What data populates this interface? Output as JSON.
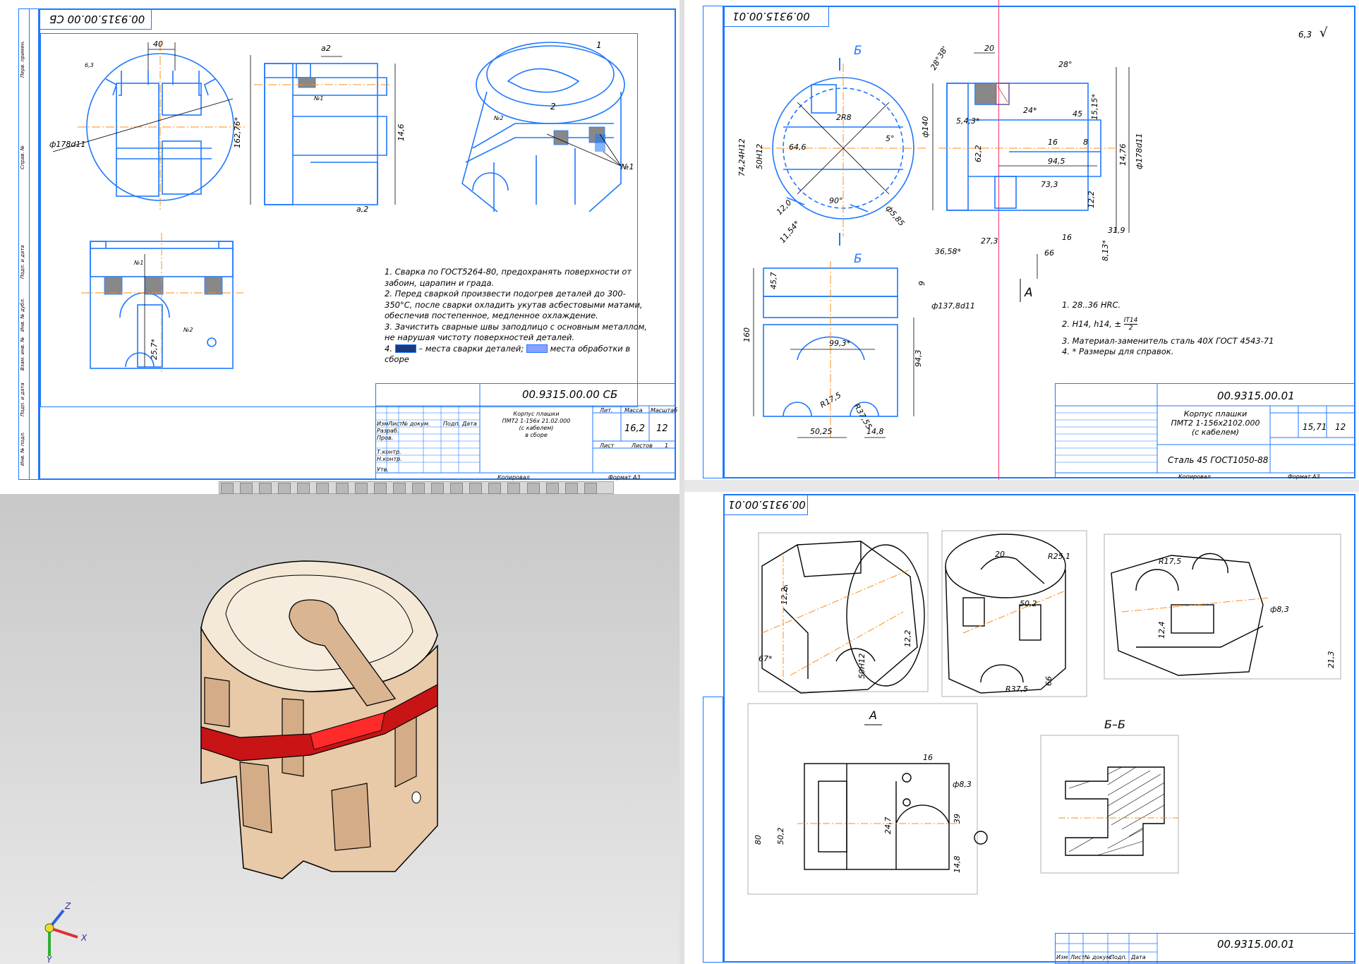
{
  "sheet1": {
    "code": "00.9315.00.00 СБ",
    "code_stamp": "00.9315.00.00 СБ",
    "title_lines": [
      "Корпус плашки",
      "ПМТ2 1-156х 21.02.000",
      "(с кабелем)",
      "в сборе"
    ],
    "lit": "Лит.",
    "mass_label": "Масса",
    "scale_label": "Масштаб",
    "mass": "16,2",
    "scale": "12",
    "sheet_label": "Лист",
    "sheets_label": "Листов",
    "sheets": "1",
    "copied": "Копировал",
    "format": "Формат",
    "format_val": "A3",
    "stamp_rows": [
      "Изм",
      "Лист",
      "№ докум.",
      "Подп.",
      "Дата",
      "Разраб.",
      "Пров.",
      "Т.контр.",
      "Н.контр.",
      "Утв."
    ],
    "notes": [
      "1. Сварка по ГОСТ5264-80, предохранять поверхности от забоин, царапин и града.",
      "2. Перед сваркой произвести подогрев деталей до 300-350°С, после сварки охладить укутав асбестовыми матами, обеспечив постепенное, медленное охлаждение.",
      "3. Зачистить сварные швы заподлицо с основным металлом, не нарушая чистоту поверхностей деталей.",
      "4.",
      "– места сварки деталей;",
      "места обработки в сборе"
    ],
    "dims": [
      "40",
      "ф178d11",
      "162,76*",
      "14,6",
      "25,7*",
      "6,3",
      "а2",
      "а,2",
      "№1",
      "№2",
      "№1",
      "1",
      "2",
      "№1",
      "№2"
    ],
    "side_labels": [
      "Перв. примен.",
      "Справ. №",
      "Подп. и дата",
      "Инв. № дубл.",
      "Взам. инв. №",
      "Подп. и дата",
      "Инв. № подл."
    ]
  },
  "sheet2": {
    "code": "00.9315.00.01",
    "code_stamp": "00.9315.00.01",
    "title_lines": [
      "Корпус плашки",
      "ПМТ2 1-156х2102.000",
      "(с кабелем)"
    ],
    "material": "Сталь 45 ГОСТ1050-88",
    "mass": "15,71",
    "scale": "12",
    "roughness": "6,3",
    "section_mark": "Б",
    "view_mark": "А",
    "notes": [
      "1. 28..36 HRC.",
      "2. H14, h14, ±",
      "IT14",
      "2",
      "3. Материал-заменитель сталь 40Х ГОСТ 4543-71",
      "4. * Размеры для справок."
    ],
    "dims": [
      "20",
      "28°38'",
      "28°",
      "24*",
      "45",
      "15,15*",
      "5,4,3*",
      "16",
      "8",
      "62,2",
      "ф140",
      "94,5",
      "73,3",
      "12,2",
      "16",
      "31,9",
      "27,3",
      "66",
      "8,13*",
      "36,58*",
      "ф178d11",
      "14,76",
      "2R8",
      "64,6",
      "74,24H12",
      "50H12",
      "90°",
      "5°",
      "12,0",
      "11,54*",
      "ф5,85",
      "45,7",
      "9",
      "ф137,8d11",
      "99,3*",
      "160",
      "94,3",
      "R17,5",
      "R37,55",
      "50,25",
      "14,8"
    ],
    "copied": "Копировал",
    "format": "Формат",
    "format_val": "A3"
  },
  "sheet3": {
    "code": "00.9315.00.01",
    "code_stamp": "00.9315.00.01",
    "view_a": "А",
    "section": "Б–Б",
    "dims": [
      "12,2",
      "R25,1",
      "20",
      "50,2",
      "R37,5",
      "66",
      "R17,5",
      "ф8,3",
      "12,4",
      "21,3",
      "67*",
      "6",
      "50H12",
      "12,2",
      "16",
      "ф8,3",
      "80",
      "50,2",
      "24,7",
      "39",
      "14,8"
    ],
    "stamp_rows": [
      "Изм",
      "Лист",
      "№ докум.",
      "Подп.",
      "Дата"
    ]
  },
  "viewport3d": {
    "axes": {
      "x": "X",
      "y": "Y",
      "z": "Z"
    },
    "colors": {
      "top": "#f4e8d6",
      "side": "#e8c9a8",
      "weld": "#c81414",
      "weld_light": "#ff2a2a",
      "bg_top": "#c8c8c8",
      "bg_bottom": "#e8e8e8"
    }
  }
}
